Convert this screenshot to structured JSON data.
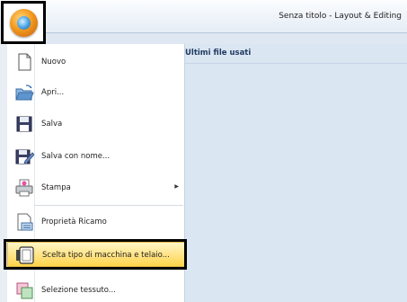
{
  "window": {
    "title": "Senza titolo - Layout & Editing"
  },
  "recent": {
    "header": "Ultimi file usati"
  },
  "menu": {
    "items": [
      {
        "label": "Nuovo",
        "icon": "new-document-icon"
      },
      {
        "label": "Apri...",
        "icon": "open-folder-icon"
      },
      {
        "label": "Salva",
        "icon": "save-disk-icon"
      },
      {
        "label": "Salva con nome...",
        "icon": "save-as-icon"
      },
      {
        "label": "Stampa",
        "icon": "printer-icon",
        "submenu": true
      },
      {
        "label": "Proprietà Ricamo",
        "icon": "properties-icon"
      },
      {
        "label": "Scelta tipo di macchina e telaio...",
        "icon": "machine-hoop-icon",
        "selected": true
      },
      {
        "label": "Selezione tessuto...",
        "icon": "fabric-icon"
      }
    ]
  },
  "colors": {
    "highlight_top": "#fff7c7",
    "highlight_bottom": "#ffd54a",
    "panel": "#dbe6f3"
  }
}
